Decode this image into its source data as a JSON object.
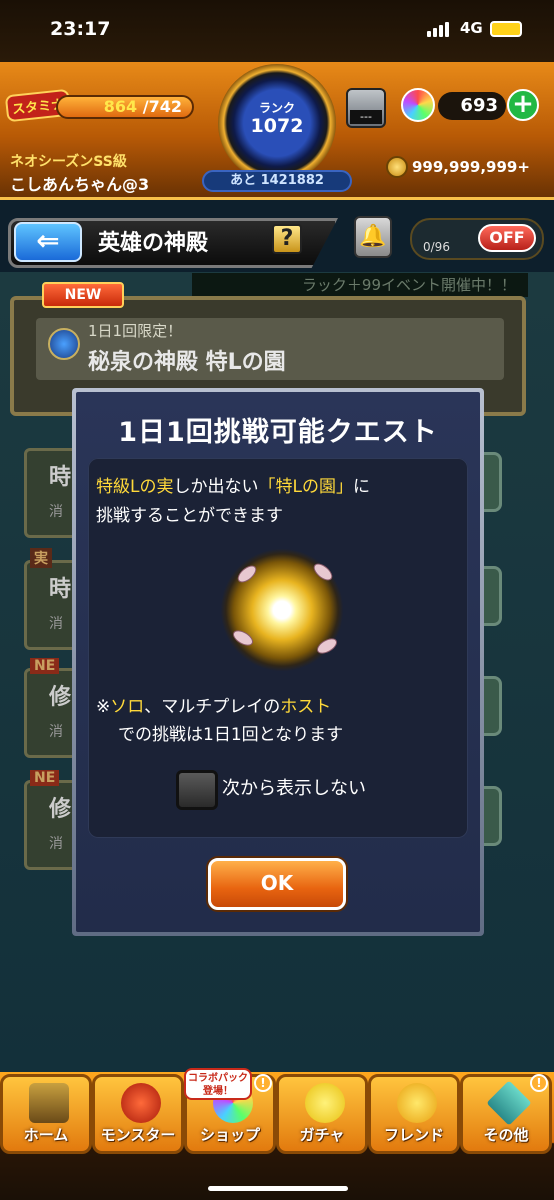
{
  "status": {
    "time": "23:17",
    "network": "4G"
  },
  "hud": {
    "stamina_label": "スタミナ",
    "stamina_current": "864",
    "stamina_max": "/742",
    "rank_label": "ランク",
    "rank_value": "1072",
    "rank_remaining": "あと 1421882",
    "season": "ネオシーズンSS級",
    "username": "こしあんちゃん@3",
    "hatch_display": "---",
    "orb_count": "693",
    "coins": "999,999,999+"
  },
  "nav": {
    "back_icon": "left-arrow-icon",
    "title": "英雄の神殿",
    "help": "?",
    "counter": "0/96",
    "off_label": "OFF"
  },
  "background_list": {
    "ticker": "ラック＋99イベント開催中！！",
    "new_badge": "NEW",
    "top_sub": "1日1回限定！",
    "top_name": "秘泉の神殿 特Lの園",
    "side_items": [
      {
        "badge": "",
        "main": "時",
        "sub": "消"
      },
      {
        "badge": "実",
        "main": "時",
        "sub": "消"
      },
      {
        "badge": "NE",
        "main": "修",
        "sub": "消"
      },
      {
        "badge": "NE",
        "main": "修",
        "sub": "消"
      }
    ]
  },
  "modal": {
    "title": "1日1回挑戦可能クエスト",
    "line1_a": "特級Lの実",
    "line1_b": "しか出ない",
    "line1_c": "「特Lの園」",
    "line1_d": "に",
    "line2": "挑戦することができます",
    "note1_a": "※",
    "note1_b": "ソロ",
    "note1_c": "、マルチプレイの",
    "note1_d": "ホスト",
    "note2": "での挑戦は1日1回となります",
    "checkbox_label": "次から表示しない",
    "ok_label": "OK"
  },
  "tabs": [
    {
      "label": "ホーム",
      "icon": "home-icon"
    },
    {
      "label": "モンスター",
      "icon": "monster-icon"
    },
    {
      "label": "ショップ",
      "icon": "shop-icon",
      "promo": "コラボパック登場！"
    },
    {
      "label": "ガチャ",
      "icon": "gacha-icon"
    },
    {
      "label": "フレンド",
      "icon": "friend-icon"
    },
    {
      "label": "その他",
      "icon": "other-icon"
    }
  ],
  "colors": {
    "accent_yellow": "#ffd93a",
    "ok_orange": "#e86410",
    "hud_orange": "#e88a18"
  }
}
